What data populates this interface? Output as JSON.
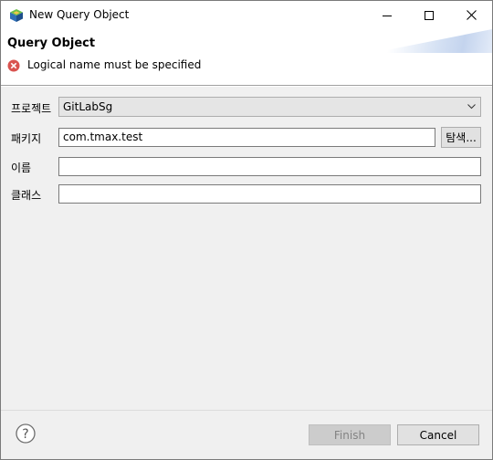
{
  "window": {
    "title": "New Query Object"
  },
  "banner": {
    "title": "Query Object",
    "error_message": "Logical name must be specified"
  },
  "form": {
    "project": {
      "label": "프로젝트",
      "value": "GitLabSg"
    },
    "package": {
      "label": "패키지",
      "value": "com.tmax.test",
      "browse_label": "탐색..."
    },
    "name": {
      "label": "이름",
      "value": ""
    },
    "class": {
      "label": "클래스",
      "value": ""
    }
  },
  "footer": {
    "finish_label": "Finish",
    "cancel_label": "Cancel"
  },
  "colors": {
    "error_red": "#d9534f",
    "disabled_text": "#838383"
  }
}
